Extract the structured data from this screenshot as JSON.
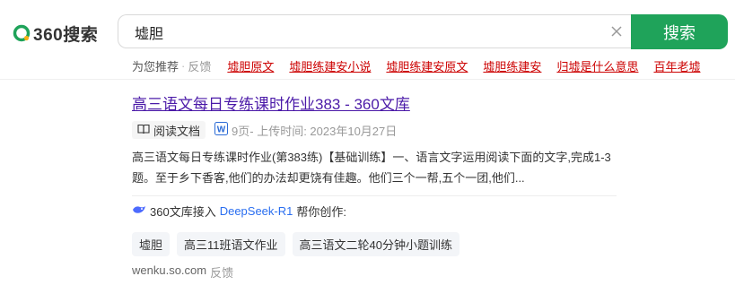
{
  "logo": {
    "text": "360搜索"
  },
  "search": {
    "query": "墟胆",
    "button_label": "搜索"
  },
  "recommend": {
    "title": "为您推荐",
    "separator": "·",
    "feedback": "反馈",
    "items": [
      "墟胆原文",
      "墟胆练建安小说",
      "墟胆练建安原文",
      "墟胆练建安",
      "归墟是什么意思",
      "百年老墟"
    ]
  },
  "result": {
    "title": "高三语文每日专练课时作业383 - 360文库",
    "read_button": "阅读文档",
    "meta_pages": "9页",
    "meta_upload": " - 上传时间: 2023年10月27日",
    "snippet": "高三语文每日专练课时作业(第383练)【基础训练】一、语言文字运用阅读下面的文字,完成1-3题。至于乡下香客,他们的办法却更饶有佳趣。他们三个一帮,五个一团,他们...",
    "ai_prefix": "360文库接入",
    "ai_model": "DeepSeek-R1",
    "ai_suffix": "帮你创作:",
    "tags": [
      "墟胆",
      "高三11班语文作业",
      "高三语文二轮40分钟小题训练"
    ],
    "source": "wenku.so.com",
    "source_feedback": "反馈"
  },
  "colors": {
    "accent": "#1fa35a",
    "link": "#4b1aa8",
    "recommend_link": "#cc0000",
    "ai_link": "#2a6ef0"
  },
  "icons": [
    "360-logo-icon",
    "clear-icon",
    "book-icon",
    "word-doc-icon",
    "deepseek-icon"
  ]
}
